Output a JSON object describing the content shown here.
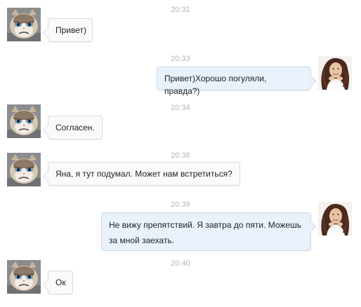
{
  "messages": [
    {
      "time": "20:31",
      "text": "Привет)",
      "direction": "incoming",
      "avatar": "cat-avatar"
    },
    {
      "time": "20:33",
      "text": "Привет)Хорошо погуляли, правда?)",
      "direction": "outgoing",
      "avatar": "woman-avatar"
    },
    {
      "time": "20:34",
      "text": "Согласен.",
      "direction": "incoming",
      "avatar": "cat-avatar"
    },
    {
      "time": "20:36",
      "text": "Яна, я тут подумал. Может нам встретиться?",
      "direction": "incoming",
      "avatar": "cat-avatar"
    },
    {
      "time": "20:39",
      "text": "Не вижу препятствий. Я завтра до пяти. Можешь за мной заехать.",
      "direction": "outgoing",
      "avatar": "woman-avatar"
    },
    {
      "time": "20:40",
      "text": "Ок",
      "direction": "incoming",
      "avatar": "cat-avatar"
    }
  ],
  "colors": {
    "incoming_bubble": "#fafafa",
    "outgoing_bubble": "#e9f2fb",
    "timestamp": "#b4b4b4"
  }
}
